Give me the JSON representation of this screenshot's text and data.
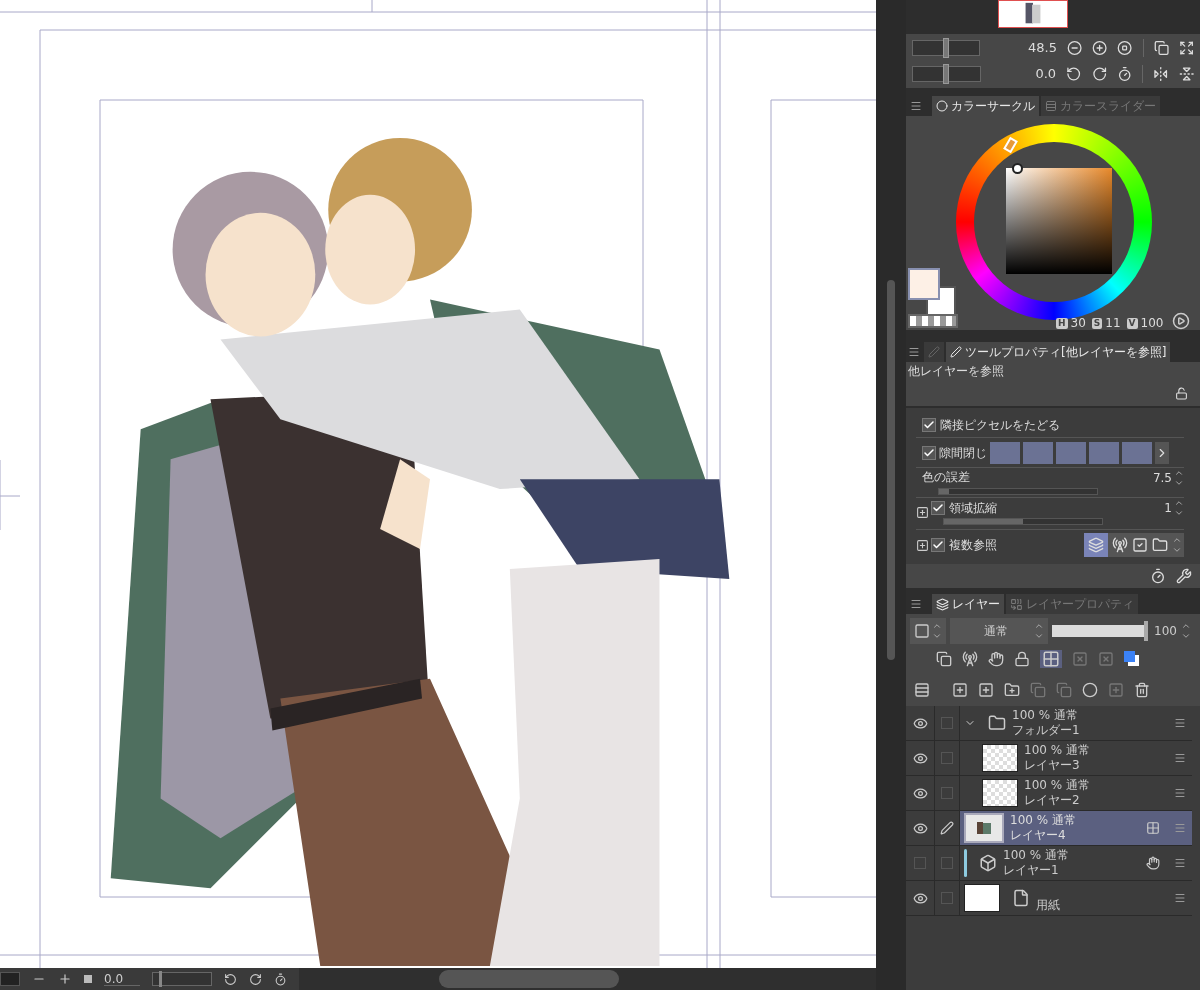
{
  "navigator": {
    "zoom": {
      "value": "48.5",
      "level": 0.5
    },
    "rotation": {
      "value": "0.0",
      "level": 0.5
    }
  },
  "color_panel": {
    "tabs": [
      {
        "label": "カラーサークル",
        "selected": true
      },
      {
        "label": "カラースライダー",
        "selected": false
      }
    ],
    "hsv": [
      {
        "key": "H",
        "value": "30"
      },
      {
        "key": "S",
        "value": "11"
      },
      {
        "key": "V",
        "value": "100"
      }
    ]
  },
  "tool_property": {
    "tabs": [
      {
        "kind": "icon",
        "selected": false
      },
      {
        "kind": "text",
        "label": "ツールプロパティ[他レイヤーを参照]",
        "selected": true
      }
    ],
    "title": "他レイヤーを参照",
    "settings": [
      {
        "kind": "check",
        "label": "隣接ピクセルをたどる",
        "checked": true
      },
      {
        "kind": "swatches",
        "label": "隙間閉じ",
        "checked": true
      },
      {
        "kind": "slider",
        "label": "色の誤差",
        "value": "7.5",
        "level": 0.05
      },
      {
        "kind": "check_slider",
        "label": "領域拡縮",
        "checked": true,
        "value": "1",
        "level": 0.5
      },
      {
        "kind": "icons",
        "label": "複数参照",
        "checked": true
      }
    ]
  },
  "layer_panel": {
    "tabs": [
      {
        "label": "レイヤー",
        "selected": true
      },
      {
        "label": "レイヤープロパティ",
        "selected": false
      }
    ],
    "blend_mode": "通常",
    "opacity": {
      "value": "100",
      "level": 1
    },
    "layers": [
      {
        "kind": "folder",
        "mode": "100 % 通常",
        "name": "フォルダー1",
        "visible": true,
        "editing": false,
        "selected": false,
        "expanded": true,
        "children": [
          {
            "kind": "raster",
            "mode": "100 % 通常",
            "name": "レイヤー3",
            "visible": true,
            "editing": false,
            "selected": false
          },
          {
            "kind": "raster",
            "mode": "100 % 通常",
            "name": "レイヤー2",
            "visible": true,
            "editing": false,
            "selected": false
          }
        ]
      },
      {
        "kind": "art",
        "mode": "100 % 通常",
        "name": "レイヤー4",
        "visible": true,
        "editing": true,
        "selected": true
      },
      {
        "kind": "reference",
        "mode": "100 % 通常",
        "name": "レイヤー1",
        "visible": false,
        "editing": false,
        "selected": false
      },
      {
        "kind": "paper",
        "name": "用紙",
        "visible": true,
        "editing": false,
        "selected": false
      }
    ]
  },
  "bottom_bar": {
    "value": "0.0",
    "level": 0.1
  }
}
